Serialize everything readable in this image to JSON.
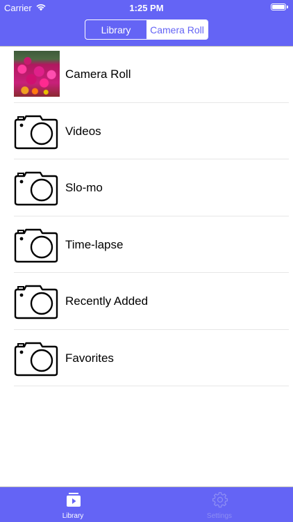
{
  "status_bar": {
    "carrier": "Carrier",
    "time": "1:25 PM",
    "battery_level_percent": 100,
    "wifi_icon": "wifi-icon"
  },
  "nav": {
    "segments": [
      {
        "label": "Library",
        "selected": false
      },
      {
        "label": "Camera Roll",
        "selected": true
      }
    ]
  },
  "albums": [
    {
      "label": "Camera Roll",
      "icon": "photo-thumbnail"
    },
    {
      "label": "Videos",
      "icon": "camera-icon"
    },
    {
      "label": "Slo-mo",
      "icon": "camera-icon"
    },
    {
      "label": "Time-lapse",
      "icon": "camera-icon"
    },
    {
      "label": "Recently Added",
      "icon": "camera-icon"
    },
    {
      "label": "Favorites",
      "icon": "camera-icon"
    }
  ],
  "tabbar": {
    "tabs": [
      {
        "label": "Library",
        "icon": "library-icon",
        "active": true
      },
      {
        "label": "Settings",
        "icon": "gear-icon",
        "active": false
      }
    ]
  },
  "colors": {
    "brand": "#6464f5",
    "tab_inactive": "#8d8df4",
    "separator": "#e6e6e6"
  }
}
